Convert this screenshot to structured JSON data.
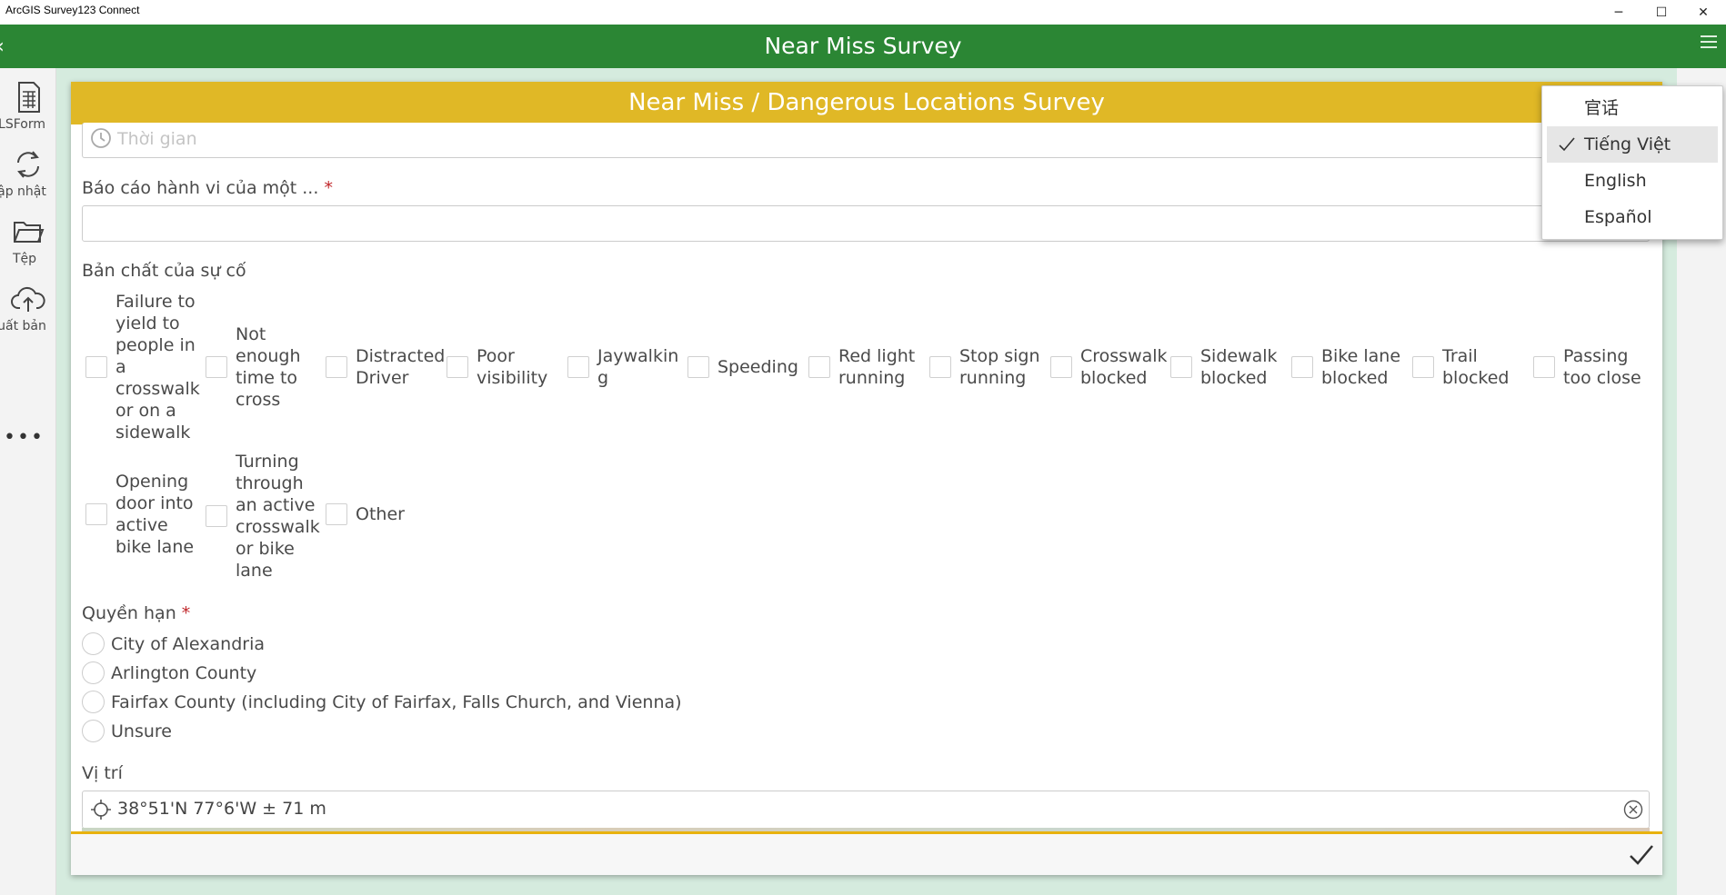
{
  "window": {
    "title": "ArcGIS Survey123 Connect",
    "minimize_glyph": "─",
    "maximize_glyph": "☐",
    "close_glyph": "✕"
  },
  "appbar": {
    "title": "Near Miss Survey",
    "back_glyph": "‹",
    "menu_icon": "hamburger-menu-icon"
  },
  "sidebar": {
    "items": [
      {
        "label": "LSForm",
        "icon": "spreadsheet-icon"
      },
      {
        "label": "ập nhật",
        "icon": "refresh-icon"
      },
      {
        "label": "Tệp",
        "icon": "folder-icon"
      },
      {
        "label": "uất bản",
        "icon": "cloud-upload-icon"
      }
    ],
    "more_glyph": "•••"
  },
  "form": {
    "header": "Near Miss / Dangerous Locations Survey",
    "time_placeholder": "Thời gian",
    "report_label": "Báo cáo hành vi của một ...",
    "required_mark": "*",
    "nature_label": "Bản chất của sự cố",
    "nature_options": [
      "Failure to yield to people in a crosswalk or on a sidewalk",
      "Not enough time to cross",
      "Distracted Driver",
      "Poor visibility",
      "Jaywalking",
      "Speeding",
      "Red light running",
      "Stop sign running",
      "Crosswalk blocked",
      "Sidewalk blocked",
      "Bike lane blocked",
      "Trail blocked",
      "Passing too close",
      "Opening door into active bike lane",
      "Turning through an active crosswalk or bike lane",
      "Other"
    ],
    "jurisdiction_label": "Quyền hạn",
    "jurisdiction_options": [
      "City of Alexandria",
      "Arlington County",
      "Fairfax County (including City of Fairfax, Falls Church, and Vienna)",
      "Unsure"
    ],
    "location_label": "Vị trí",
    "location_value": "38°51'N 77°6'W ± 71 m"
  },
  "language_menu": {
    "options": [
      "官话",
      "Tiếng Việt",
      "English",
      "Español"
    ],
    "selected": "Tiếng Việt"
  },
  "colors": {
    "appbar": "#2b8634",
    "form_header": "#e0b826",
    "background_panel": "#d5ebde",
    "required": "#c0262a"
  }
}
